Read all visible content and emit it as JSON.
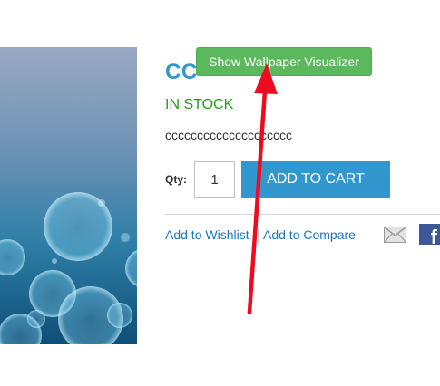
{
  "product": {
    "title": "CC",
    "stock_status": "IN STOCK",
    "short_description": "cccccccccccccccccccc"
  },
  "visualizer": {
    "button_label": "Show Wallpaper Visualizer",
    "color": "#5cb85c"
  },
  "purchase": {
    "qty_label": "Qty:",
    "qty_value": "1",
    "add_to_cart_label": "ADD TO CART",
    "accent_color": "#3397cf"
  },
  "actions": {
    "wishlist_label": "Add to Wishlist",
    "compare_label": "Add to Compare",
    "email_icon": "email-icon",
    "facebook_icon": "facebook-icon",
    "facebook_letter": "f"
  },
  "annotation": {
    "arrow_color": "#ee0b1f"
  },
  "product_image": {
    "description_icon": "product-image"
  }
}
